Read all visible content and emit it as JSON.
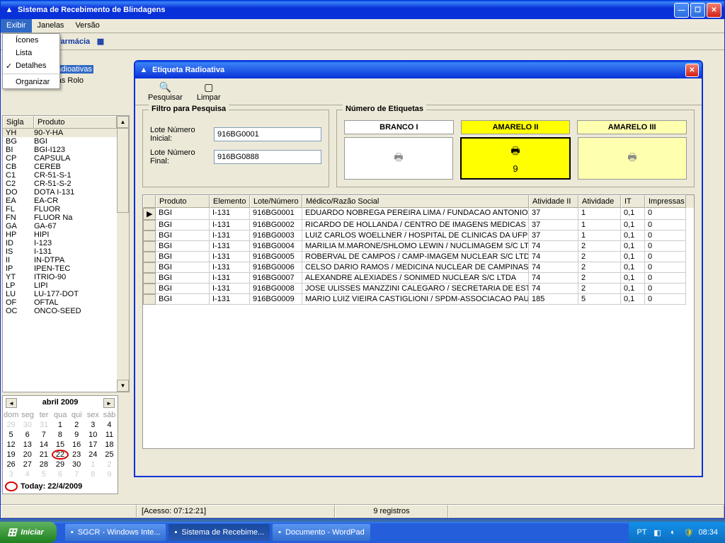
{
  "main_window": {
    "title": "Sistema de Recebimento de Blindagens"
  },
  "menubar": {
    "items": [
      "Exibir",
      "Janelas",
      "Versão"
    ]
  },
  "dropdown": {
    "items": [
      "Ícones",
      "Lista",
      "Detalhes"
    ],
    "checked_index": 2,
    "footer": "Organizar"
  },
  "app_header": "ntro de Radiofarmácia",
  "tree": {
    "items": [
      "estas Radioativas",
      "Etiquestas Rolo"
    ],
    "selected_index": 0
  },
  "product_list": {
    "headers": [
      "Sigla",
      "Produto"
    ],
    "rows": [
      [
        "YH",
        "90-Y-HA"
      ],
      [
        "BG",
        "BGI"
      ],
      [
        "BI",
        "BGI-I123"
      ],
      [
        "CP",
        "CAPSULA"
      ],
      [
        "CB",
        "CEREB"
      ],
      [
        "C1",
        "CR-51-S-1"
      ],
      [
        "C2",
        "CR-51-S-2"
      ],
      [
        "DO",
        "DOTA I-131"
      ],
      [
        "EA",
        "EA-CR"
      ],
      [
        "FL",
        "FLUOR"
      ],
      [
        "FN",
        "FLUOR Na"
      ],
      [
        "GA",
        "GA-67"
      ],
      [
        "HP",
        "HIPI"
      ],
      [
        "ID",
        "I-123"
      ],
      [
        "IS",
        "I-131"
      ],
      [
        "II",
        "IN-DTPA"
      ],
      [
        "IP",
        "IPEN-TEC"
      ],
      [
        "YT",
        "ITRIO-90"
      ],
      [
        "LP",
        "LIPI"
      ],
      [
        "LU",
        "LU-177-DOT"
      ],
      [
        "OF",
        "OFTAL"
      ],
      [
        "OC",
        "ONCO-SEED"
      ]
    ],
    "selected_index": 0
  },
  "calendar": {
    "month": "abril 2009",
    "day_headers": [
      "dom",
      "seg",
      "ter",
      "qua",
      "qui",
      "sex",
      "sáb"
    ],
    "weeks": [
      [
        {
          "d": 29,
          "o": true
        },
        {
          "d": 30,
          "o": true
        },
        {
          "d": 31,
          "o": true
        },
        {
          "d": 1
        },
        {
          "d": 2
        },
        {
          "d": 3
        },
        {
          "d": 4
        }
      ],
      [
        {
          "d": 5
        },
        {
          "d": 6
        },
        {
          "d": 7
        },
        {
          "d": 8
        },
        {
          "d": 9
        },
        {
          "d": 10
        },
        {
          "d": 11
        }
      ],
      [
        {
          "d": 12
        },
        {
          "d": 13
        },
        {
          "d": 14
        },
        {
          "d": 15
        },
        {
          "d": 16
        },
        {
          "d": 17
        },
        {
          "d": 18
        }
      ],
      [
        {
          "d": 19
        },
        {
          "d": 20
        },
        {
          "d": 21
        },
        {
          "d": 22,
          "c": true
        },
        {
          "d": 23
        },
        {
          "d": 24
        },
        {
          "d": 25
        }
      ],
      [
        {
          "d": 26
        },
        {
          "d": 27
        },
        {
          "d": 28
        },
        {
          "d": 29
        },
        {
          "d": 30
        },
        {
          "d": 1,
          "o": true
        },
        {
          "d": 2,
          "o": true
        }
      ],
      [
        {
          "d": 3,
          "o": true
        },
        {
          "d": 4,
          "o": true
        },
        {
          "d": 5,
          "o": true
        },
        {
          "d": 6,
          "o": true
        },
        {
          "d": 7,
          "o": true
        },
        {
          "d": 8,
          "o": true
        },
        {
          "d": 9,
          "o": true
        }
      ]
    ],
    "today": "Today: 22/4/2009"
  },
  "child_window": {
    "title": "Etiqueta Radioativa",
    "toolbar": {
      "pesquisar": "Pesquisar",
      "limpar": "Limpar"
    },
    "filter": {
      "legend": "Filtro para Pesquisa",
      "lote_inicial_label": "Lote Número Inicial:",
      "lote_inicial": "916BG0001",
      "lote_final_label": "Lote Número Final:",
      "lote_final": "916BG0888"
    },
    "labels": {
      "legend": "Número de Etiquetas",
      "branco": "BRANCO I",
      "amarelo2": "AMARELO II",
      "amarelo3": "AMARELO III",
      "count2": "9"
    },
    "grid": {
      "headers": [
        "",
        "Produto",
        "Elemento",
        "Lote/Número",
        "Médico/Razão Social",
        "Atividade II",
        "Atividade",
        "IT",
        "Impressas"
      ],
      "rows": [
        {
          "sel": "▶",
          "p": "BGI",
          "e": "I-131",
          "l": "916BG0001",
          "m": "EDUARDO NOBREGA PEREIRA LIMA / FUNDACAO ANTONIO PR",
          "a2": "37",
          "a": "1",
          "it": "0,1",
          "imp": "0"
        },
        {
          "sel": "",
          "p": "BGI",
          "e": "I-131",
          "l": "916BG0002",
          "m": "RICARDO DE HOLLANDA / CENTRO DE IMAGENS MEDICAS CU",
          "a2": "37",
          "a": "1",
          "it": "0,1",
          "imp": "0"
        },
        {
          "sel": "",
          "p": "BGI",
          "e": "I-131",
          "l": "916BG0003",
          "m": "LUIZ CARLOS WOELLNER / HOSPITAL DE CLINICAS DA UFPR",
          "a2": "37",
          "a": "1",
          "it": "0,1",
          "imp": "0"
        },
        {
          "sel": "",
          "p": "BGI",
          "e": "I-131",
          "l": "916BG0004",
          "m": "MARILIA M.MARONE/SHLOMO LEWIN / NUCLIMAGEM S/C LTD",
          "a2": "74",
          "a": "2",
          "it": "0,1",
          "imp": "0"
        },
        {
          "sel": "",
          "p": "BGI",
          "e": "I-131",
          "l": "916BG0005",
          "m": "ROBERVAL DE CAMPOS / CAMP-IMAGEM NUCLEAR S/C LTDA",
          "a2": "74",
          "a": "2",
          "it": "0,1",
          "imp": "0"
        },
        {
          "sel": "",
          "p": "BGI",
          "e": "I-131",
          "l": "916BG0006",
          "m": "CELSO DARIO RAMOS / MEDICINA NUCLEAR DE CAMPINAS S/",
          "a2": "74",
          "a": "2",
          "it": "0,1",
          "imp": "0"
        },
        {
          "sel": "",
          "p": "BGI",
          "e": "I-131",
          "l": "916BG0007",
          "m": "ALEXANDRE ALEXIADES / SONIMED NUCLEAR S/C LTDA",
          "a2": "74",
          "a": "2",
          "it": "0,1",
          "imp": "0"
        },
        {
          "sel": "",
          "p": "BGI",
          "e": "I-131",
          "l": "916BG0008",
          "m": "JOSE ULISSES MANZZINI CALEGARO / SECRETARIA DE ESTAD",
          "a2": "74",
          "a": "2",
          "it": "0,1",
          "imp": "0"
        },
        {
          "sel": "",
          "p": "BGI",
          "e": "I-131",
          "l": "916BG0009",
          "m": "MARIO LUIZ VIEIRA CASTIGLIONI / SPDM-ASSOCIACAO PAULIS",
          "a2": "185",
          "a": "5",
          "it": "0,1",
          "imp": "0"
        }
      ]
    }
  },
  "statusbar": {
    "acesso": "[Acesso: 07:12:21]",
    "registros": "9 registros"
  },
  "taskbar": {
    "start": "Iniciar",
    "items": [
      {
        "label": "SGCR - Windows Inte...",
        "active": false
      },
      {
        "label": "Sistema de Recebime...",
        "active": true
      },
      {
        "label": "Documento - WordPad",
        "active": false
      }
    ],
    "lang": "PT",
    "time": "08:34"
  }
}
